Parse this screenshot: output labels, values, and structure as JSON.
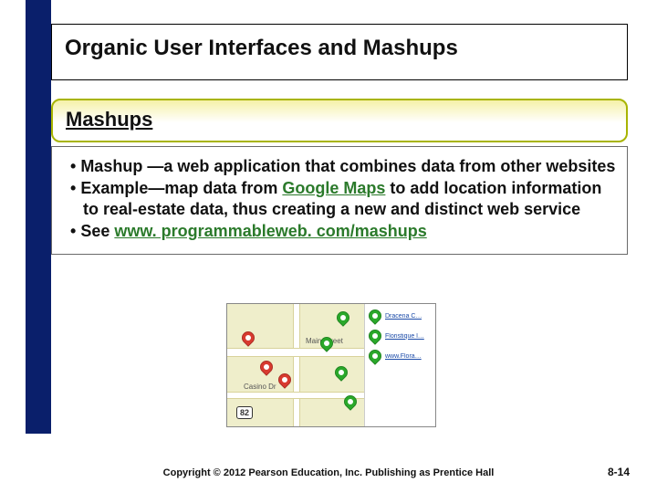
{
  "title": "Organic User Interfaces and Mashups",
  "section_header": "Mashups",
  "bullets": [
    {
      "prefix": "Mashup —",
      "text": "a web application that combines data from other websites"
    },
    {
      "prefix": "Example—",
      "text_before": "map data from ",
      "link": "Google Maps",
      "text_after": " to add location information to real-estate data, thus creating a new and distinct web service"
    },
    {
      "prefix": "See ",
      "link": "www. programmableweb. com/mashups"
    }
  ],
  "map": {
    "label_main": "Main Street",
    "label_casino": "Casino Dr",
    "shield": "82",
    "sidebar": [
      "Dracena C…",
      "Floristique l…",
      "www.Flora…"
    ]
  },
  "footer": "Copyright © 2012 Pearson Education, Inc. Publishing as Prentice Hall",
  "page_number": "8-14"
}
